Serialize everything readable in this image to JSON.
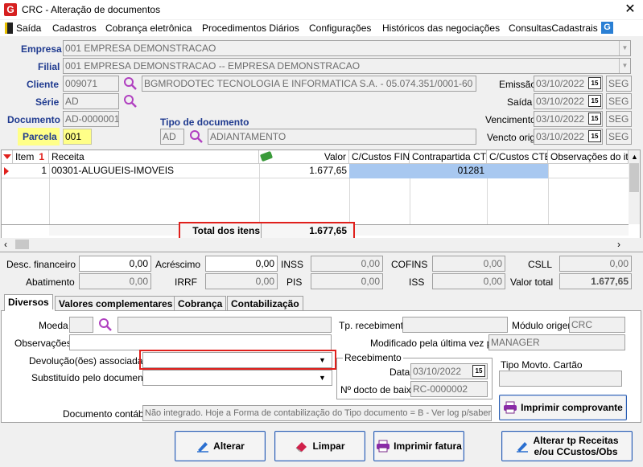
{
  "window": {
    "title": "CRC - Alteração de documentos",
    "app_icon": "G",
    "close": "✕"
  },
  "menu": [
    "Saída",
    "Cadastros",
    "Cobrança eletrônica",
    "Procedimentos Diários",
    "Configurações",
    "Históricos das negociações",
    "ConsultasCadastrais"
  ],
  "header": {
    "empresa_label": "Empresa",
    "empresa_value": "001 EMPRESA DEMONSTRACAO",
    "filial_label": "Filial",
    "filial_value": "001 EMPRESA DEMONSTRACAO -- EMPRESA DEMONSTRACAO",
    "cliente_label": "Cliente",
    "cliente_code": "009071",
    "cliente_name": "BGMRODOTEC TECNOLOGIA E INFORMATICA S.A. - 05.074.351/0001-60",
    "serie_label": "Série",
    "serie_value": "AD",
    "documento_label": "Documento",
    "documento_value": "AD-0000001",
    "parcela_label": "Parcela",
    "parcela_value": "001",
    "tipo_doc_label": "Tipo de documento",
    "tipo_doc_code": "AD",
    "tipo_doc_name": "ADIANTAMENTO",
    "emissao_label": "Emissão",
    "emissao_value": "03/10/2022",
    "emissao_day": "SEG",
    "saida_label": "Saída",
    "saida_value": "03/10/2022",
    "saida_day": "SEG",
    "vencimento_label": "Vencimento",
    "vencimento_value": "03/10/2022",
    "vencimento_day": "SEG",
    "vencto_orig_label": "Vencto orig",
    "vencto_orig_value": "03/10/2022",
    "vencto_orig_day": "SEG",
    "cal_icon": "15"
  },
  "grid": {
    "columns": [
      "Item",
      "Receita",
      "Valor",
      "C/Custos FIN",
      "Contrapartida CTB",
      "C/Custos CTB",
      "Observações do item"
    ],
    "rows": [
      {
        "item": "1",
        "receita": "00301-ALUGUEIS-IMOVEIS",
        "valor": "1.677,65",
        "c_custos_fin": "",
        "contrapartida": "01281",
        "c_custos_ctb": "",
        "obs": ""
      }
    ],
    "total_label": "Total dos itens",
    "total_value": "1.677,65"
  },
  "totals": {
    "desc_financeiro_label": "Desc. financeiro",
    "desc_financeiro": "0,00",
    "acrescimo_label": "Acréscimo",
    "acrescimo": "0,00",
    "inss_label": "INSS",
    "inss": "0,00",
    "cofins_label": "COFINS",
    "cofins": "0,00",
    "csll_label": "CSLL",
    "csll": "0,00",
    "abatimento_label": "Abatimento",
    "abatimento": "0,00",
    "irrf_label": "IRRF",
    "irrf": "0,00",
    "pis_label": "PIS",
    "pis": "0,00",
    "iss_label": "ISS",
    "iss": "0,00",
    "valor_total_label": "Valor total",
    "valor_total": "1.677,65"
  },
  "tabs": [
    "Diversos",
    "Valores complementares",
    "Cobrança",
    "Contabilização"
  ],
  "diversos": {
    "moeda_label": "Moeda",
    "observacoes_label": "Observações",
    "devolucao_label": "Devolução(ões) associada(s)",
    "substituido_label": "Substituído pelo documento",
    "doc_contabil_label": "Documento contábil",
    "doc_contabil_value": "Não integrado. Hoje a Forma de contabilização do Tipo documento = B - Ver log p/saber o",
    "tp_recebimento_label": "Tp. recebimento",
    "modulo_origem_label": "Módulo origem",
    "modulo_origem_value": "CRC",
    "modificado_label": "Modificado pela última vez por",
    "modificado_value": "MANAGER",
    "recebimento_label": "Recebimento",
    "data_label": "Data",
    "data_value": "03/10/2022",
    "docto_baixa_label": "Nº docto de baixa",
    "docto_baixa_value": "RC-0000002",
    "tipo_movto_label": "Tipo Movto. Cartão",
    "imprimir_comprovante": "Imprimir comprovante"
  },
  "buttons": {
    "alterar": "Alterar",
    "limpar": "Limpar",
    "imprimir_fatura": "Imprimir fatura",
    "alterar_tp_line1": "Alterar tp Receitas",
    "alterar_tp_line2": "e/ou CCustos/Obs"
  },
  "colors": {
    "accent_blue": "#1f3a8f",
    "highlight_red": "#e0201c",
    "selected_cell": "#a8c8f0",
    "parcela_yellow": "#ffff88"
  }
}
